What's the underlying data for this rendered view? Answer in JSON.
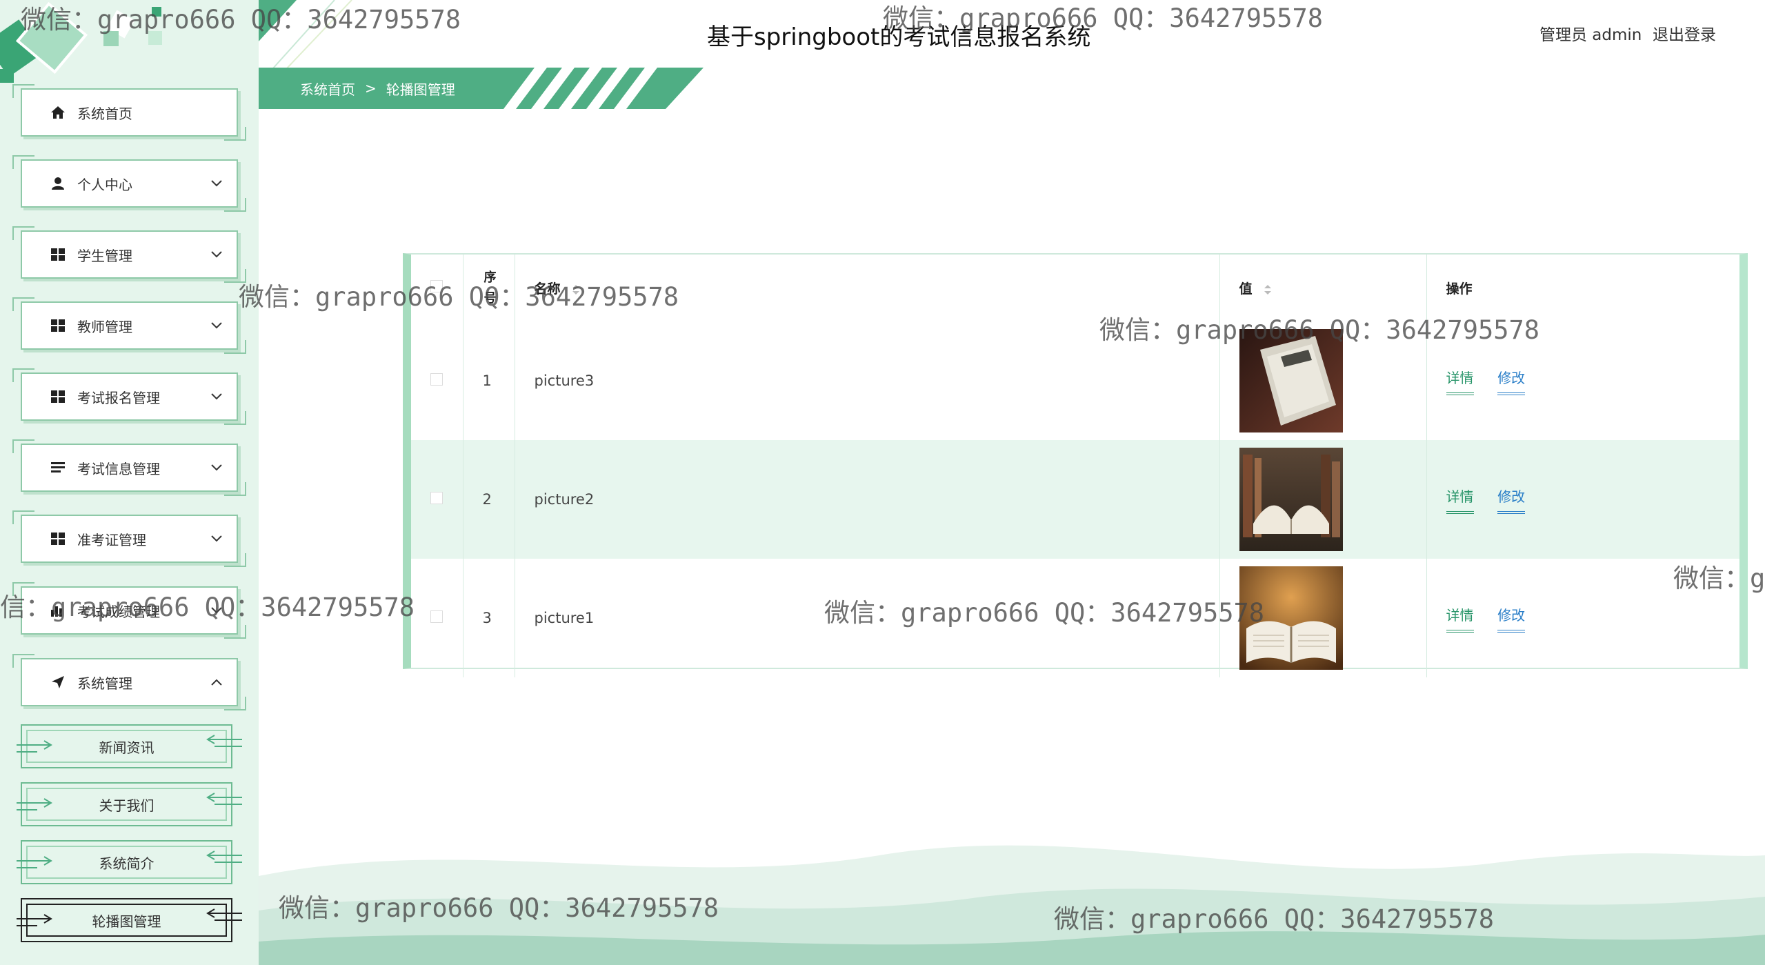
{
  "header": {
    "app_title": "基于springboot的考试信息报名系统",
    "user_info": "管理员 admin",
    "logout_label": "退出登录"
  },
  "breadcrumb": {
    "home": "系统首页",
    "separator": ">",
    "current": "轮播图管理"
  },
  "sidebar": {
    "items": [
      {
        "label": "系统首页",
        "icon": "home-icon"
      },
      {
        "label": "个人中心",
        "icon": "user-icon",
        "arrow": "chevron-down-icon"
      },
      {
        "label": "学生管理",
        "icon": "grid-icon",
        "arrow": "chevron-down-icon"
      },
      {
        "label": "教师管理",
        "icon": "grid-icon",
        "arrow": "chevron-down-icon"
      },
      {
        "label": "考试报名管理",
        "icon": "grid-icon",
        "arrow": "chevron-down-icon"
      },
      {
        "label": "考试信息管理",
        "icon": "list-icon",
        "arrow": "chevron-down-icon"
      },
      {
        "label": "准考证管理",
        "icon": "grid-icon",
        "arrow": "chevron-down-icon"
      },
      {
        "label": "考试成绩管理",
        "icon": "chart-icon",
        "arrow": "chevron-down-icon"
      },
      {
        "label": "系统管理",
        "icon": "send-icon",
        "arrow": "chevron-up-icon"
      }
    ],
    "sub_items": [
      {
        "label": "新闻资讯"
      },
      {
        "label": "关于我们"
      },
      {
        "label": "系统简介"
      },
      {
        "label": "轮播图管理",
        "active": true
      }
    ]
  },
  "table": {
    "columns": {
      "index": "序号",
      "name": "名称",
      "value": "值",
      "actions": "操作"
    },
    "rows": [
      {
        "index": "1",
        "name": "picture3",
        "image": "book-on-table"
      },
      {
        "index": "2",
        "name": "picture2",
        "image": "open-book-library"
      },
      {
        "index": "3",
        "name": "picture1",
        "image": "open-book-warm"
      }
    ],
    "detail_label": "详情",
    "edit_label": "修改"
  },
  "watermark": {
    "text_full": "微信：grapro666 QQ：3642795578",
    "text_left_cut": "信：grapro666 QQ：3642795578",
    "text_right_cut": "微信：g"
  },
  "colors": {
    "primary_green": "#4fae84",
    "sidebar_bg": "#e5f5ec",
    "row_alt_bg": "#e7f6ee",
    "detail_link": "#29956a",
    "edit_link": "#2b7fc8"
  }
}
